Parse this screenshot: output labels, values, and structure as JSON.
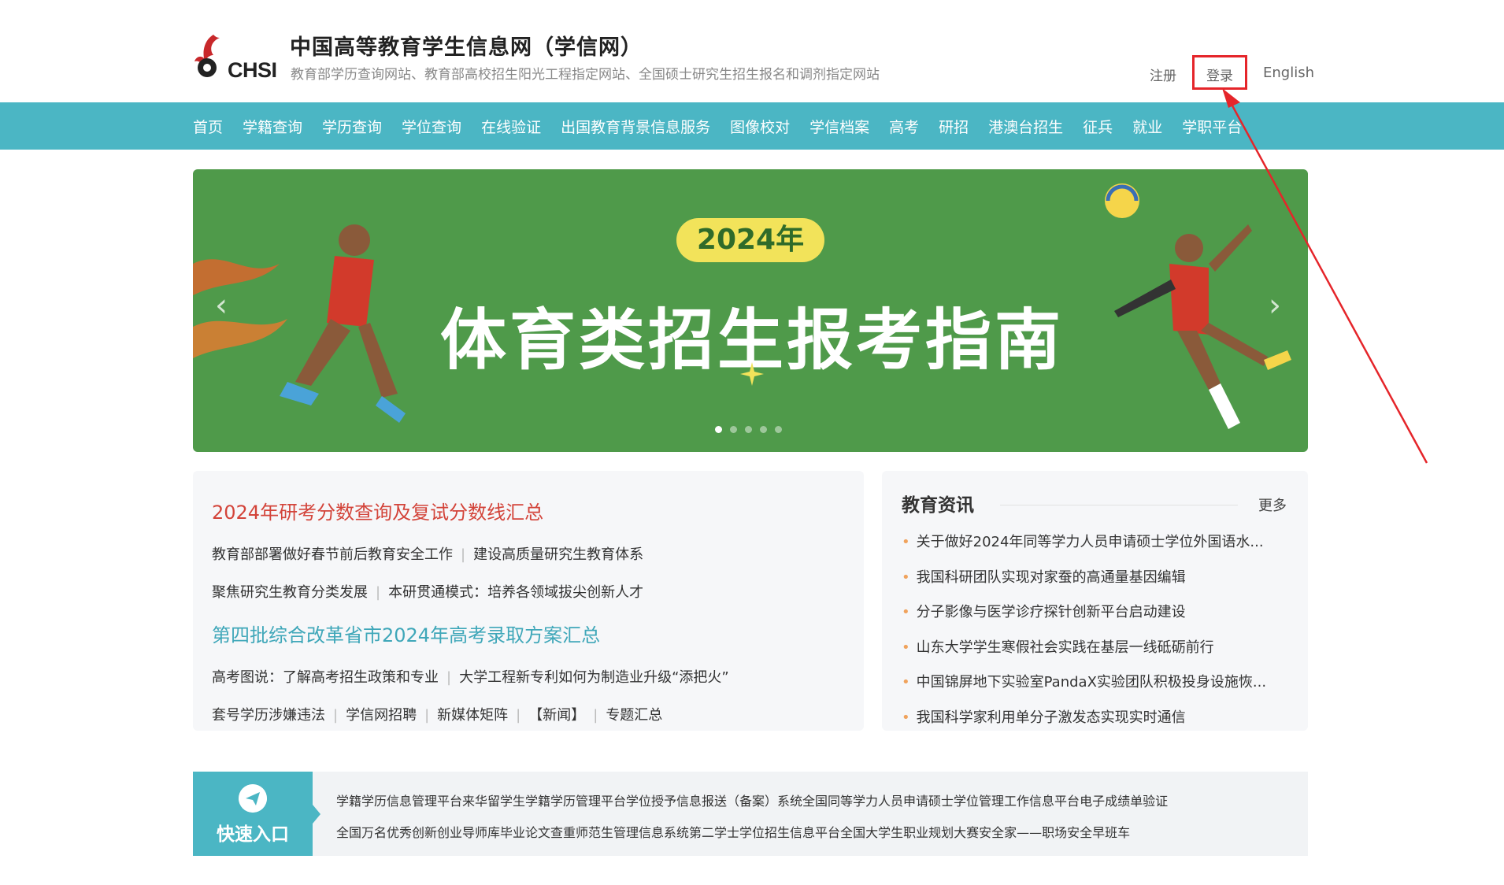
{
  "header": {
    "logo_text": "CHSI",
    "title": "中国高等教育学生信息网（学信网）",
    "subtitle": "教育部学历查询网站、教育部高校招生阳光工程指定网站、全国硕士研究生招生报名和调剂指定网站",
    "links": {
      "register": "注册",
      "login": "登录",
      "english": "English"
    }
  },
  "nav": {
    "items": [
      "首页",
      "学籍查询",
      "学历查询",
      "学位查询",
      "在线验证",
      "出国教育背景信息服务",
      "图像校对",
      "学信档案",
      "高考",
      "研招",
      "港澳台招生",
      "征兵",
      "就业",
      "学职平台"
    ]
  },
  "banner": {
    "year": "2024年",
    "title": "体育类招生报考指南",
    "arrow_left": "‹",
    "arrow_right": "›"
  },
  "news_left": {
    "headline1": "2024年研考分数查询及复试分数线汇总",
    "row1": [
      "教育部部署做好春节前后教育安全工作",
      "建设高质量研究生教育体系"
    ],
    "row2": [
      "聚焦研究生教育分类发展",
      "本研贯通模式：培养各领域拔尖创新人才"
    ],
    "headline2": "第四批综合改革省市2024年高考录取方案汇总",
    "row3": [
      "高考图说：了解高考招生政策和专业",
      "大学工程新专利如何为制造业升级“添把火”"
    ],
    "row4": [
      "套号学历涉嫌违法",
      "学信网招聘",
      "新媒体矩阵",
      "【新闻】",
      "专题汇总"
    ]
  },
  "news_right": {
    "title": "教育资讯",
    "more": "更多",
    "items": [
      "关于做好2024年同等学力人员申请硕士学位外国语水...",
      "我国科研团队实现对家蚕的高通量基因编辑",
      "分子影像与医学诊疗探针创新平台启动建设",
      "山东大学学生寒假社会实践在基层一线砥砺前行",
      "中国锦屏地下实验室PandaX实验团队积极投身设施恢...",
      "我国科学家利用单分子激发态实现实时通信"
    ]
  },
  "quick": {
    "label": "快速入口",
    "row1": [
      "学籍学历信息管理平台",
      "来华留学生学籍学历管理平台",
      "学位授予信息报送（备案）系统",
      "全国同等学力人员申请硕士学位管理工作信息平台",
      "电子成绩单验证"
    ],
    "row2": [
      "全国万名优秀创新创业导师库",
      "毕业论文查重",
      "师范生管理信息系统",
      "第二学士学位招生信息平台",
      "全国大学生职业规划大赛",
      "安全家——职场安全早班车"
    ]
  },
  "colors": {
    "nav": "#4bb6c4",
    "banner": "#4f9a4a",
    "headline_red": "#d3443a",
    "headline_teal": "#3fa7b9",
    "annotation": "#e5252a"
  }
}
